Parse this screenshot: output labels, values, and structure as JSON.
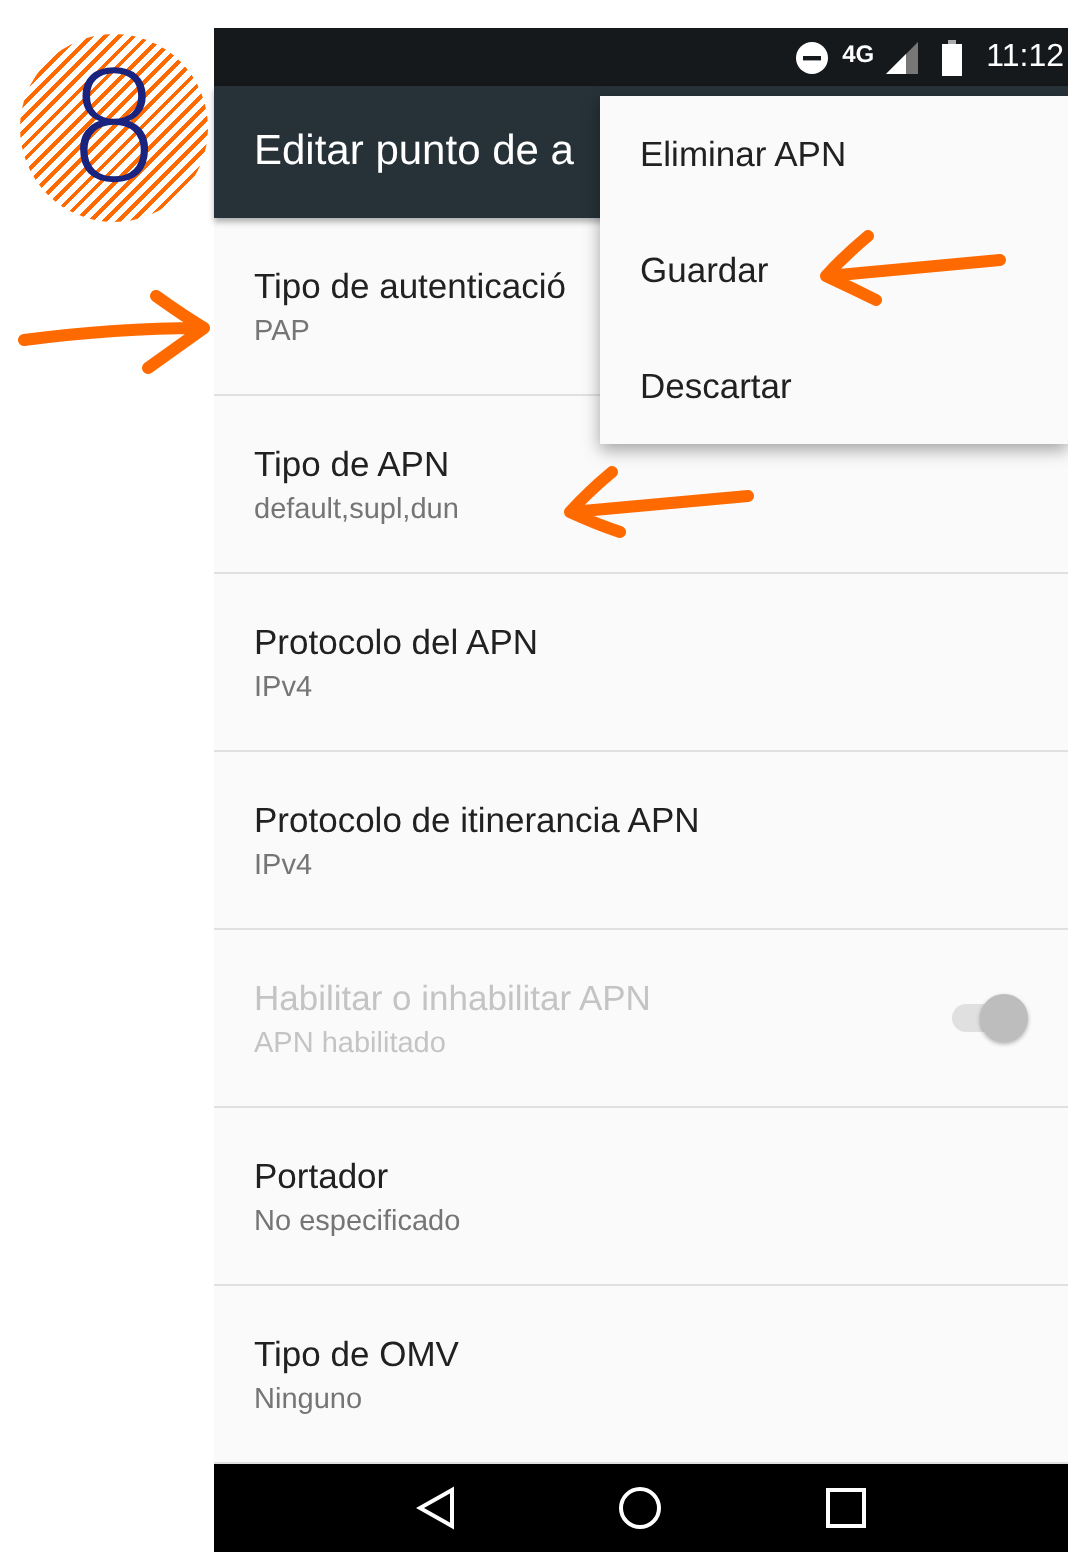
{
  "step_badge": "8",
  "status_bar": {
    "network": "4G",
    "time": "11:12"
  },
  "toolbar": {
    "title": "Editar punto de a"
  },
  "settings": [
    {
      "kind": "text",
      "title": "Tipo de autenticació",
      "summary": "PAP",
      "disabled": false
    },
    {
      "kind": "text",
      "title": "Tipo de APN",
      "summary": "default,supl,dun",
      "disabled": false
    },
    {
      "kind": "text",
      "title": "Protocolo del APN",
      "summary": "IPv4",
      "disabled": false
    },
    {
      "kind": "text",
      "title": "Protocolo de itinerancia APN",
      "summary": "IPv4",
      "disabled": false
    },
    {
      "kind": "switch",
      "title": "Habilitar o inhabilitar APN",
      "summary": "APN habilitado",
      "disabled": true,
      "on": true
    },
    {
      "kind": "text",
      "title": "Portador",
      "summary": "No especificado",
      "disabled": false
    },
    {
      "kind": "text",
      "title": "Tipo de OMV",
      "summary": "Ninguno",
      "disabled": false
    }
  ],
  "menu": {
    "items": [
      "Eliminar APN",
      "Guardar",
      "Descartar"
    ]
  }
}
